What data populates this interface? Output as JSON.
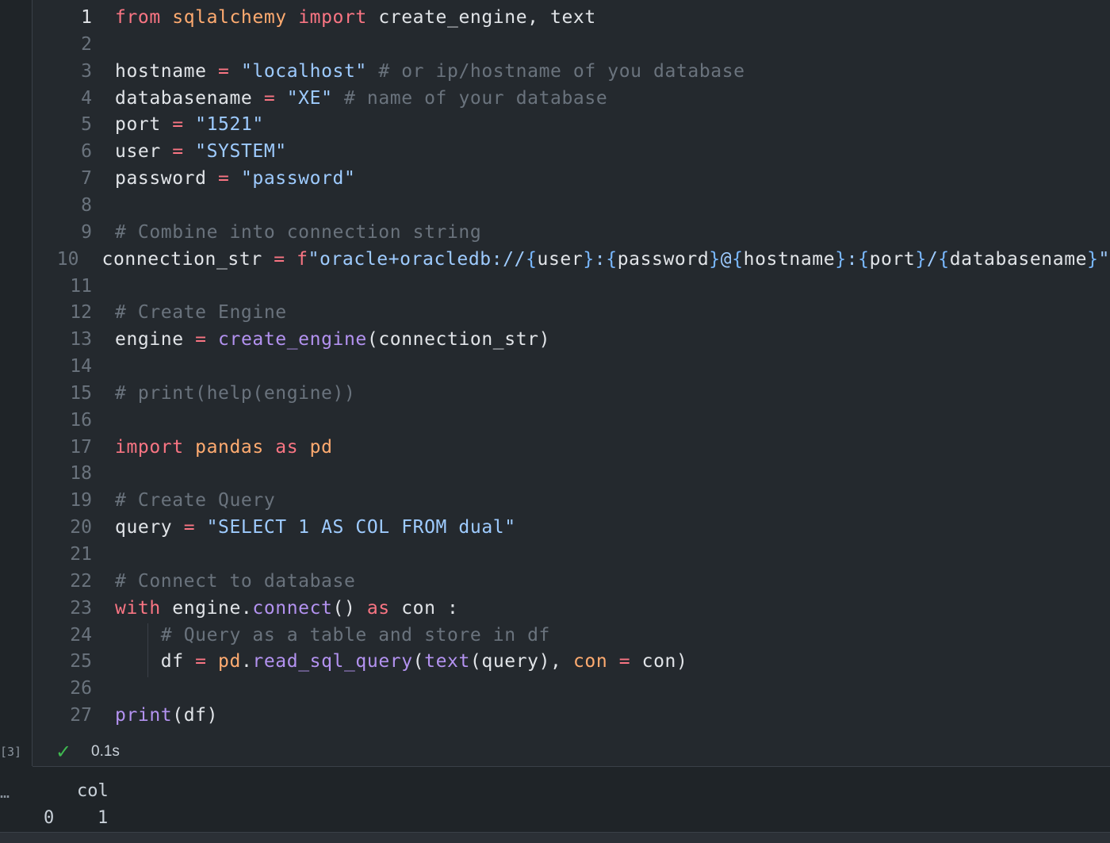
{
  "code_lines": [
    {
      "n": "1",
      "active": true,
      "tokens": [
        [
          "kw",
          "from"
        ],
        [
          "pl",
          " "
        ],
        [
          "mod",
          "sqlalchemy"
        ],
        [
          "pl",
          " "
        ],
        [
          "kw",
          "import"
        ],
        [
          "pl",
          " create_engine, text"
        ]
      ]
    },
    {
      "n": "2",
      "tokens": []
    },
    {
      "n": "3",
      "tokens": [
        [
          "pl",
          "hostname "
        ],
        [
          "op",
          "="
        ],
        [
          "pl",
          " "
        ],
        [
          "str",
          "\"localhost\""
        ],
        [
          "pl",
          " "
        ],
        [
          "cm",
          "# or ip/hostname of you database"
        ]
      ]
    },
    {
      "n": "4",
      "tokens": [
        [
          "pl",
          "databasename "
        ],
        [
          "op",
          "="
        ],
        [
          "pl",
          " "
        ],
        [
          "str",
          "\"XE\""
        ],
        [
          "pl",
          " "
        ],
        [
          "cm",
          "# name of your database"
        ]
      ]
    },
    {
      "n": "5",
      "tokens": [
        [
          "pl",
          "port "
        ],
        [
          "op",
          "="
        ],
        [
          "pl",
          " "
        ],
        [
          "str",
          "\"1521\""
        ]
      ]
    },
    {
      "n": "6",
      "tokens": [
        [
          "pl",
          "user "
        ],
        [
          "op",
          "="
        ],
        [
          "pl",
          " "
        ],
        [
          "str",
          "\"SYSTEM\""
        ]
      ]
    },
    {
      "n": "7",
      "tokens": [
        [
          "pl",
          "password "
        ],
        [
          "op",
          "="
        ],
        [
          "pl",
          " "
        ],
        [
          "str",
          "\"password\""
        ]
      ]
    },
    {
      "n": "8",
      "tokens": []
    },
    {
      "n": "9",
      "tokens": [
        [
          "cm",
          "# Combine into connection string"
        ]
      ]
    },
    {
      "n": "10",
      "tokens": [
        [
          "pl",
          "connection_str "
        ],
        [
          "op",
          "="
        ],
        [
          "pl",
          " "
        ],
        [
          "op",
          "f"
        ],
        [
          "str",
          "\"oracle+oracledb://"
        ],
        [
          "num",
          "{"
        ],
        [
          "pl",
          "user"
        ],
        [
          "num",
          "}"
        ],
        [
          "str",
          ":"
        ],
        [
          "num",
          "{"
        ],
        [
          "pl",
          "password"
        ],
        [
          "num",
          "}"
        ],
        [
          "str",
          "@"
        ],
        [
          "num",
          "{"
        ],
        [
          "pl",
          "hostname"
        ],
        [
          "num",
          "}"
        ],
        [
          "str",
          ":"
        ],
        [
          "num",
          "{"
        ],
        [
          "pl",
          "port"
        ],
        [
          "num",
          "}"
        ],
        [
          "str",
          "/"
        ],
        [
          "num",
          "{"
        ],
        [
          "pl",
          "databasename"
        ],
        [
          "num",
          "}"
        ],
        [
          "str",
          "\""
        ]
      ]
    },
    {
      "n": "11",
      "tokens": []
    },
    {
      "n": "12",
      "tokens": [
        [
          "cm",
          "# Create Engine"
        ]
      ]
    },
    {
      "n": "13",
      "tokens": [
        [
          "pl",
          "engine "
        ],
        [
          "op",
          "="
        ],
        [
          "pl",
          " "
        ],
        [
          "fn",
          "create_engine"
        ],
        [
          "pl",
          "(connection_str)"
        ]
      ]
    },
    {
      "n": "14",
      "tokens": []
    },
    {
      "n": "15",
      "tokens": [
        [
          "cm",
          "# print(help(engine))"
        ]
      ]
    },
    {
      "n": "16",
      "tokens": []
    },
    {
      "n": "17",
      "tokens": [
        [
          "kw",
          "import"
        ],
        [
          "pl",
          " "
        ],
        [
          "mod",
          "pandas"
        ],
        [
          "pl",
          " "
        ],
        [
          "kw",
          "as"
        ],
        [
          "pl",
          " "
        ],
        [
          "mod",
          "pd"
        ]
      ]
    },
    {
      "n": "18",
      "tokens": []
    },
    {
      "n": "19",
      "tokens": [
        [
          "cm",
          "# Create Query"
        ]
      ]
    },
    {
      "n": "20",
      "tokens": [
        [
          "pl",
          "query "
        ],
        [
          "op",
          "="
        ],
        [
          "pl",
          " "
        ],
        [
          "str",
          "\"SELECT 1 AS COL FROM dual\""
        ]
      ]
    },
    {
      "n": "21",
      "tokens": []
    },
    {
      "n": "22",
      "tokens": [
        [
          "cm",
          "# Connect to database"
        ]
      ]
    },
    {
      "n": "23",
      "tokens": [
        [
          "kw",
          "with"
        ],
        [
          "pl",
          " engine."
        ],
        [
          "fn",
          "connect"
        ],
        [
          "pl",
          "() "
        ],
        [
          "kw",
          "as"
        ],
        [
          "pl",
          " con :"
        ]
      ]
    },
    {
      "n": "24",
      "tokens": [
        [
          "pl",
          "    "
        ],
        [
          "cm",
          "# Query as a table and store in df"
        ]
      ]
    },
    {
      "n": "25",
      "tokens": [
        [
          "pl",
          "    df "
        ],
        [
          "op",
          "="
        ],
        [
          "pl",
          " "
        ],
        [
          "mod",
          "pd"
        ],
        [
          "pl",
          "."
        ],
        [
          "fn",
          "read_sql_query"
        ],
        [
          "pl",
          "("
        ],
        [
          "fn",
          "text"
        ],
        [
          "pl",
          "(query), "
        ],
        [
          "mod",
          "con"
        ],
        [
          "pl",
          " "
        ],
        [
          "op",
          "="
        ],
        [
          "pl",
          " con)"
        ]
      ]
    },
    {
      "n": "26",
      "tokens": []
    },
    {
      "n": "27",
      "tokens": [
        [
          "fn",
          "print"
        ],
        [
          "pl",
          "(df)"
        ]
      ]
    }
  ],
  "status": {
    "exec_count": "[3]",
    "check_icon": "check-icon",
    "time": "0.1s"
  },
  "output": {
    "ellipsis": "…",
    "header": "col",
    "row_index": "0",
    "row_value": "1"
  },
  "colors": {
    "keyword": "#f97583",
    "function": "#b392f0",
    "string": "#9ecbff",
    "comment": "#6a737d",
    "module": "#ffab70",
    "success": "#3fb950"
  }
}
